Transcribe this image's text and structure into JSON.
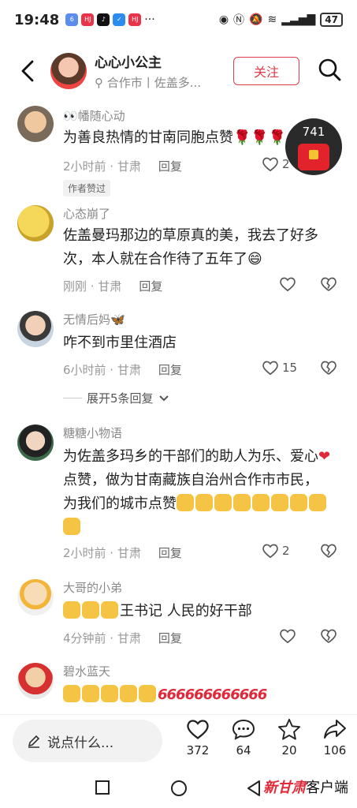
{
  "status": {
    "time": "19:48",
    "battery": "47"
  },
  "header": {
    "name": "心心小公主",
    "location": "合作市丨佐盖多...",
    "follow": "关注"
  },
  "redpacket": {
    "count": "741"
  },
  "comments": [
    {
      "user": "👀幡随心动",
      "text": "为善良热情的甘南同胞点赞🌹🌹🌹",
      "time": "2小时前 · 甘肃",
      "reply": "回复",
      "likes": "2",
      "badge": "作者赞过"
    },
    {
      "user": "心态崩了",
      "text": "佐盖曼玛那边的草原真的美，我去了好多次，本人就在合作待了五年了😄",
      "time": "刚刚 · 甘肃",
      "reply": "回复",
      "likes": ""
    },
    {
      "user": "无情后妈🦋",
      "text": "咋不到市里住酒店",
      "time": "6小时前 · 甘肃",
      "reply": "回复",
      "likes": "15",
      "expand": "展开5条回复"
    },
    {
      "user": "糖糖小物语",
      "text_a": "为佐盖多玛乡的干部们的助人为乐、爱心",
      "text_b": "点赞，做为甘南藏族自治州合作市市民，为我们的城市点赞",
      "heart": "❤",
      "time": "2小时前 · 甘肃",
      "reply": "回复",
      "likes": "2"
    },
    {
      "user": "大哥的小弟",
      "text": "王书记  人民的好干部",
      "time": "4分钟前 · 甘肃",
      "reply": "回复",
      "likes": ""
    },
    {
      "user": "碧水蓝天",
      "text": "666666666666"
    }
  ],
  "bottom": {
    "placeholder": "说点什么...",
    "likes": "372",
    "comments": "64",
    "stars": "20",
    "shares": "106"
  },
  "watermark": {
    "brand": "新甘肃",
    "suffix": "客户端"
  }
}
